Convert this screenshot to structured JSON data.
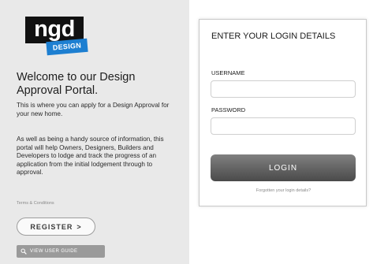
{
  "brand": {
    "logo_top": "ngd",
    "logo_bottom": "DESIGN"
  },
  "left_panel": {
    "welcome_title": "Welcome to our Design Approval Portal.",
    "intro": "This is where you can apply for a Design Approval for your new home.",
    "info": "As well as being a handy source of information, this portal will help Owners, Designers, Builders and Developers to lodge and track the progress of an application from the initial lodgement through to approval.",
    "terms_link": "Terms & Conditions",
    "register_label": "REGISTER",
    "register_arrow": ">",
    "guide_label": "VIEW USER GUIDE",
    "guide_icon": "magnifier-icon"
  },
  "login": {
    "heading": "ENTER YOUR LOGIN DETAILS",
    "username_label": "USERNAME",
    "username_value": "",
    "password_label": "PASSWORD",
    "password_value": "",
    "button_label": "LOGIN",
    "forgot_link": "Forgotten your login details?"
  }
}
